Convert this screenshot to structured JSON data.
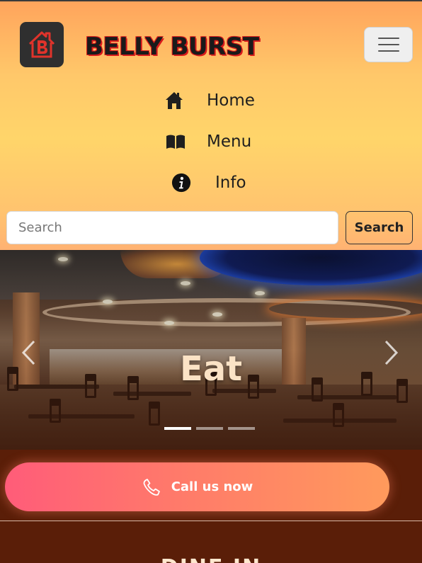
{
  "brand": {
    "name": "BELLY BURST"
  },
  "nav": {
    "items": [
      {
        "label": "Home",
        "icon": "home-icon"
      },
      {
        "label": "Menu",
        "icon": "book-icon"
      },
      {
        "label": "Info",
        "icon": "info-icon"
      }
    ]
  },
  "search": {
    "placeholder": "Search",
    "value": "",
    "button_label": "Search"
  },
  "carousel": {
    "caption": "Eat",
    "slide_count": 3,
    "active_slide": 1
  },
  "cta": {
    "label": "Call us now",
    "icon": "phone-icon"
  },
  "section": {
    "heading": "DINE IN"
  },
  "colors": {
    "header_top": "#ffa45c",
    "header_mid": "#ffd56a",
    "page_bg": "#5a1e08",
    "cta_start": "#ff5c79",
    "cta_end": "#ff9a5c",
    "brand_outline": "#d81b1b"
  }
}
